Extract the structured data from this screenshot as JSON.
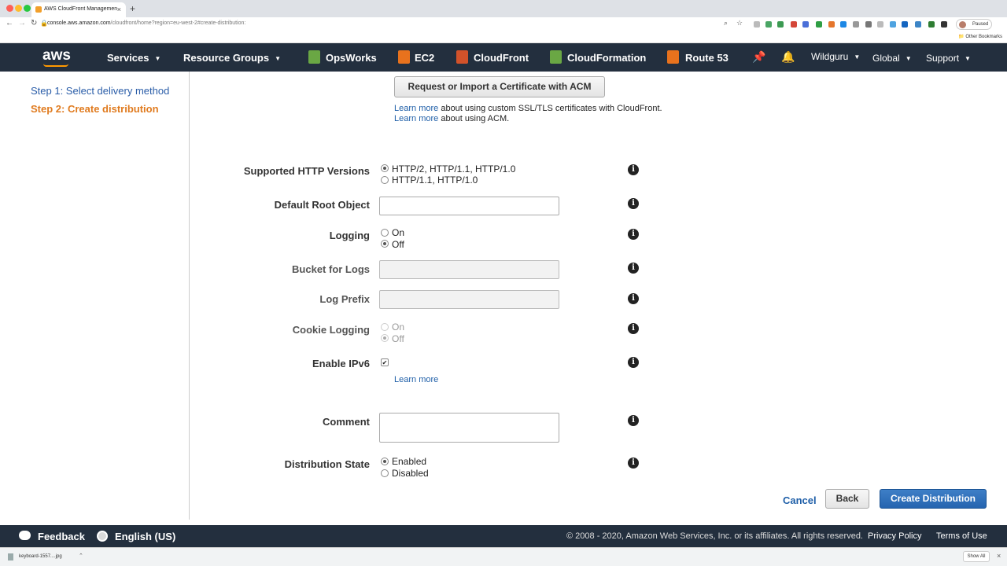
{
  "browser": {
    "tab_title": "AWS CloudFront Managemen",
    "url_host": "console.aws.amazon.com",
    "url_path": "/cloudfront/home?region=eu-west-2#create-distribution:",
    "profile_status": "Paused",
    "other_bookmarks": "Other Bookmarks",
    "download_file": "keyboard-1557....jpg",
    "show_all": "Show All"
  },
  "aws_nav": {
    "logo": "aws",
    "services": "Services",
    "resource_groups": "Resource Groups",
    "shortcuts": [
      {
        "label": "OpsWorks",
        "color": "#6aa744"
      },
      {
        "label": "EC2",
        "color": "#e8721d"
      },
      {
        "label": "CloudFront",
        "color": "#d2522a"
      },
      {
        "label": "CloudFormation",
        "color": "#6aa744"
      },
      {
        "label": "Route 53",
        "color": "#e8721d"
      }
    ],
    "user": "Wildguru",
    "region": "Global",
    "support": "Support"
  },
  "sidebar": {
    "step1": "Step 1: Select delivery method",
    "step2": "Step 2: Create distribution"
  },
  "form": {
    "acm_button": "Request or Import a Certificate with ACM",
    "note1_link": "Learn more",
    "note1_text": "about using custom SSL/TLS certificates with CloudFront.",
    "note2_link": "Learn more",
    "note2_text": "about using ACM.",
    "http_versions_label": "Supported HTTP Versions",
    "http_versions_options": [
      "HTTP/2, HTTP/1.1, HTTP/1.0",
      "HTTP/1.1, HTTP/1.0"
    ],
    "http_versions_selected": "HTTP/2, HTTP/1.1, HTTP/1.0",
    "root_object_label": "Default Root Object",
    "root_object_value": "",
    "logging_label": "Logging",
    "logging_options": [
      "On",
      "Off"
    ],
    "logging_selected": "Off",
    "bucket_label": "Bucket for Logs",
    "bucket_value": "",
    "prefix_label": "Log Prefix",
    "prefix_value": "",
    "cookie_label": "Cookie Logging",
    "cookie_options": [
      "On",
      "Off"
    ],
    "cookie_selected": "Off",
    "ipv6_label": "Enable IPv6",
    "ipv6_checked": true,
    "ipv6_learn_more": "Learn more",
    "comment_label": "Comment",
    "comment_value": "",
    "state_label": "Distribution State",
    "state_options": [
      "Enabled",
      "Disabled"
    ],
    "state_selected": "Enabled",
    "info_glyph": "i"
  },
  "actions": {
    "cancel": "Cancel",
    "back": "Back",
    "create": "Create Distribution"
  },
  "footer": {
    "feedback": "Feedback",
    "language": "English (US)",
    "copyright": "© 2008 - 2020, Amazon Web Services, Inc. or its affiliates. All rights reserved.",
    "privacy": "Privacy Policy",
    "terms": "Terms of Use"
  },
  "colors": {
    "nav_bg": "#232f3e",
    "accent_orange": "#e07b1f",
    "link_blue": "#1f5fa8",
    "primary_button": "#2564b0"
  }
}
